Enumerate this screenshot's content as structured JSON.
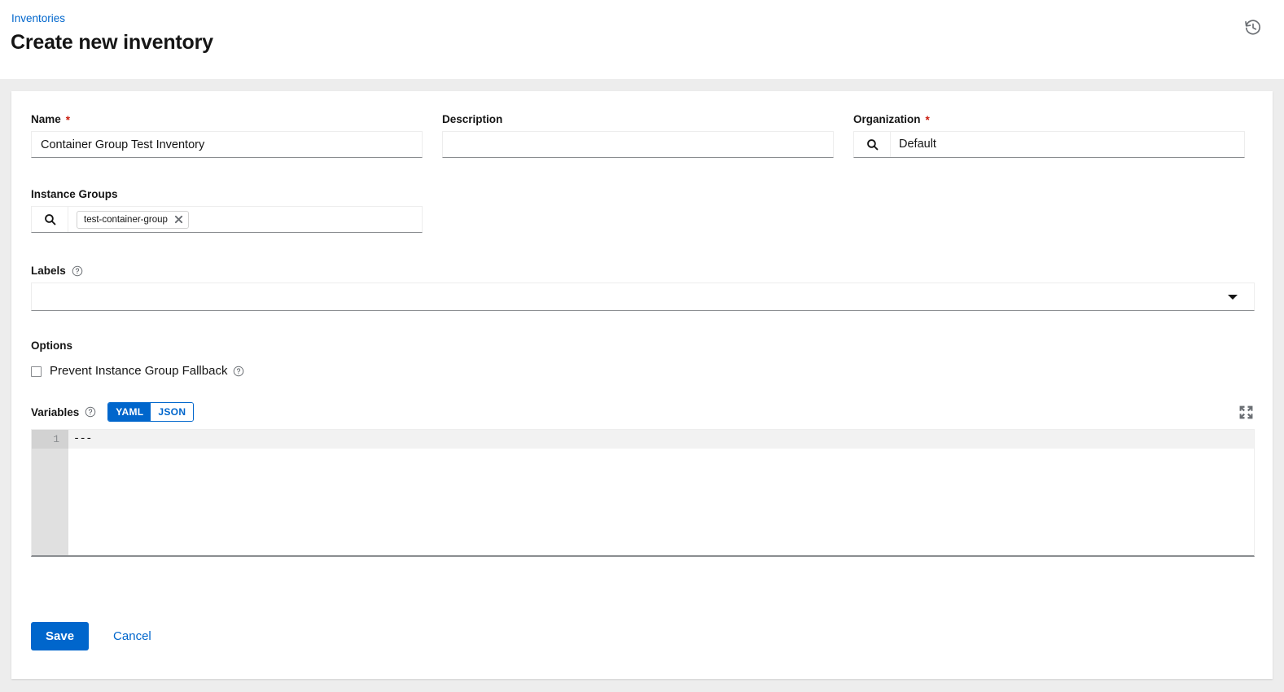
{
  "header": {
    "breadcrumb": "Inventories",
    "title": "Create new inventory",
    "history_icon": "history-icon"
  },
  "form": {
    "name": {
      "label": "Name",
      "required_marker": "*",
      "value": "Container Group Test Inventory",
      "placeholder": ""
    },
    "description": {
      "label": "Description",
      "value": "",
      "placeholder": ""
    },
    "organization": {
      "label": "Organization",
      "required_marker": "*",
      "value": "Default",
      "search_icon": "search-icon"
    },
    "instance_groups": {
      "label": "Instance Groups",
      "search_icon": "search-icon",
      "chips": [
        {
          "label": "test-container-group",
          "close_icon": "close-icon"
        }
      ]
    },
    "labels": {
      "label": "Labels",
      "help_icon": "question-circle-icon",
      "value": "",
      "placeholder": "",
      "caret_icon": "chevron-down-icon"
    },
    "options": {
      "label": "Options",
      "checkboxes": [
        {
          "label": "Prevent Instance Group Fallback",
          "checked": false,
          "help_icon": "question-circle-icon"
        }
      ]
    },
    "variables": {
      "label": "Variables",
      "help_icon": "question-circle-icon",
      "modes": [
        {
          "label": "YAML",
          "active": true
        },
        {
          "label": "JSON",
          "active": false
        }
      ],
      "expand_icon": "expand-icon",
      "lines": [
        {
          "number": "1",
          "text": "---"
        }
      ]
    }
  },
  "actions": {
    "save_label": "Save",
    "cancel_label": "Cancel"
  },
  "colors": {
    "accent": "#0066cc",
    "required": "#c9190b",
    "page_bg": "#ededed",
    "card_bg": "#ffffff",
    "text": "#151515",
    "muted": "#6a6e73"
  }
}
